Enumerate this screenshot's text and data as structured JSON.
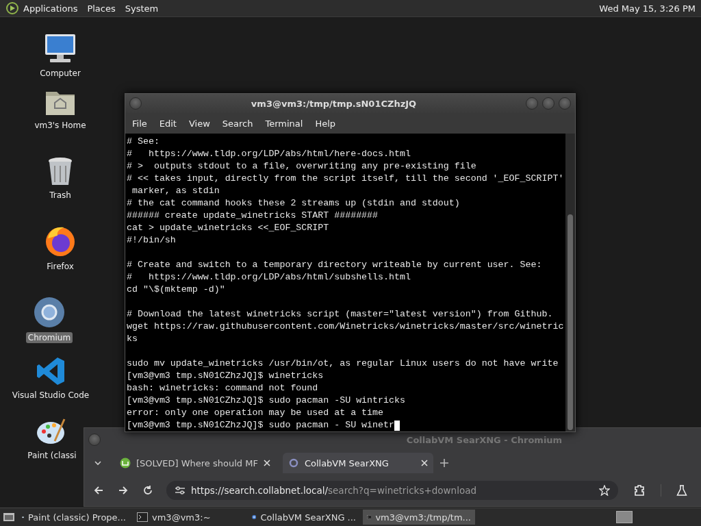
{
  "top_panel": {
    "menus": [
      "Applications",
      "Places",
      "System"
    ],
    "clock": "Wed May 15,  3:26 PM"
  },
  "desktop_icons": [
    {
      "kind": "computer",
      "label": "Computer",
      "selected": false
    },
    {
      "kind": "home",
      "label": "vm3's Home",
      "selected": false
    },
    {
      "kind": "trash",
      "label": "Trash",
      "selected": false
    },
    {
      "kind": "firefox",
      "label": "Firefox",
      "selected": false
    },
    {
      "kind": "chromium",
      "label": "Chromium",
      "selected": true
    },
    {
      "kind": "vscode",
      "label": "Visual Studio Code",
      "selected": false
    },
    {
      "kind": "paint",
      "label": "Paint (classi",
      "selected": false
    }
  ],
  "terminal": {
    "title": "vm3@vm3:/tmp/tmp.sN01CZhzJQ",
    "menu": [
      "File",
      "Edit",
      "View",
      "Search",
      "Terminal",
      "Help"
    ],
    "blocks": [
      {
        "lines": [
          {
            "text": "# See:"
          },
          {
            "text": "#   https://www.tldp.org/LDP/abs/html/here-docs.html"
          },
          {
            "text": "# >  outputs stdout to a file, overwriting any pre-existing file"
          },
          {
            "text": "# << takes input, directly from the script itself, till the second '_EOF_SCRIPT'"
          },
          {
            "text": " marker, as stdin"
          },
          {
            "text": "# the cat command hooks these 2 streams up (stdin and stdout)"
          },
          {
            "text": "###### create update_winetricks START ########"
          },
          {
            "text": "cat > update_winetricks <<_EOF_SCRIPT"
          },
          {
            "text": "#!/bin/sh"
          }
        ]
      },
      {
        "lines": [
          {
            "text": "# Create and switch to a temporary directory writeable by current user. See:"
          },
          {
            "text": "#   https://www.tldp.org/LDP/abs/html/subshells.html"
          },
          {
            "text": "cd \"\\$(mktemp -d)\""
          }
        ]
      },
      {
        "lines": [
          {
            "text": "# Download the latest winetricks script (master=\"latest version\") from Github."
          },
          {
            "text": "wget https://raw.githubusercontent.com/Winetricks/winetricks/master/src/winetric"
          },
          {
            "text": "ks"
          }
        ]
      },
      {
        "lines": [
          {
            "text": "sudo mv update_winetricks /usr/bin/ot, as regular Linux users do not have write"
          },
          {
            "text": "[vm3@vm3 tmp.sN01CZhzJQ]$ winetricks"
          },
          {
            "text": "bash: winetricks: command not found"
          },
          {
            "text": "[vm3@vm3 tmp.sN01CZhzJQ]$ sudo pacman -SU wintricks"
          },
          {
            "text": "error: only one operation may be used at a time"
          },
          {
            "text": "[vm3@vm3 tmp.sN01CZhzJQ]$ sudo pacman - SU winetr",
            "cursor": true
          }
        ]
      }
    ]
  },
  "browser": {
    "title": "CollabVM SearXNG - Chromium",
    "tabs": [
      {
        "kind": "mint",
        "title": "[SOLVED] Where should MF",
        "selected": false
      },
      {
        "kind": "searx",
        "title": "CollabVM SearXNG",
        "selected": true
      }
    ],
    "url_host": "https://search.collabnet.local/",
    "url_rest": "search?q=winetricks+download"
  },
  "taskbar": [
    {
      "kind": "paint",
      "label": "Paint (classic) Prope...",
      "selected": false
    },
    {
      "kind": "terminal",
      "label": "vm3@vm3:~",
      "selected": false
    },
    {
      "kind": "chromium",
      "label": "CollabVM SearXNG ...",
      "selected": false
    },
    {
      "kind": "terminal",
      "label": "vm3@vm3:/tmp/tm...",
      "selected": true
    }
  ]
}
